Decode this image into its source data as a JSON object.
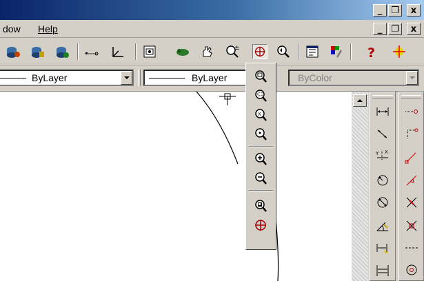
{
  "window": {
    "minimize_glyph": "_",
    "restore_glyph": "❐",
    "close_glyph": "x"
  },
  "menu": {
    "items": [
      "dow",
      "Help"
    ],
    "doc_minimize_glyph": "_",
    "doc_restore_glyph": "❐",
    "doc_close_glyph": "x"
  },
  "toolbar": {
    "icons": [
      "dbconnect-icon",
      "open-icon",
      "export-icon",
      "distance-icon",
      "ucs-icon",
      "aerial-view-icon",
      "pan-realtime-icon",
      "pan-hand-icon",
      "zoom-realtime-icon",
      "zoom-window-icon",
      "zoom-previous-icon",
      "properties-icon",
      "match-properties-icon",
      "help-icon",
      "light-icon"
    ]
  },
  "properties": {
    "linetype": "ByLayer",
    "lineweight": "ByLayer",
    "plotstyle": "ByColor"
  },
  "zoom_flyout": {
    "items": [
      "zoom-window-icon",
      "zoom-dynamic-icon",
      "zoom-scale-icon",
      "zoom-center-icon",
      "zoom-in-icon",
      "zoom-out-icon",
      "zoom-all-icon",
      "zoom-extents-icon"
    ]
  },
  "dimension_toolbar": {
    "items": [
      "linear-dimension-icon",
      "aligned-dimension-icon",
      "ordinate-dimension-icon",
      "radius-dimension-icon",
      "diameter-dimension-icon",
      "angular-dimension-icon",
      "quick-dimension-icon",
      "baseline-dimension-icon"
    ]
  },
  "osnap_toolbar": {
    "items": [
      "temporary-tracking-icon",
      "snap-from-icon",
      "snap-endpoint-icon",
      "snap-midpoint-icon",
      "snap-intersection-icon",
      "snap-apparent-intersection-icon",
      "snap-extension-icon",
      "snap-center-icon"
    ]
  },
  "colors": {
    "chrome": "#d4d0c8",
    "title_start": "#0a246a",
    "title_end": "#a6caf0"
  }
}
